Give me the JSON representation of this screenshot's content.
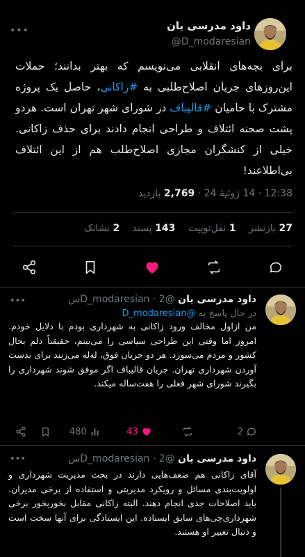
{
  "main_tweet": {
    "author_name": "داود مدرسی یان",
    "handle": "@D_modaresian",
    "text_parts": [
      "برای بچه‌های انقلابی می‌نویسم که بهتر بدانند؛ حملات این‌روزهای جریان اصلاح‌طلبی به ",
      "#زاکانی",
      "، حاصل یک پروژه مشترک با حامیان ",
      "#قالیباف",
      " در شورای شهر تهران است. هردو پشت صحنه ائتلاف و طراحی انجام دادند برای حذف زاکانی. خیلی از کنشگران مجازی اصلاح‌طلب هم از این ائتلاف بی‌اطلاعند!"
    ],
    "time": "12:38",
    "date": "14 ژوئیهٔ 24",
    "views": "2,769",
    "views_label": "بازدید",
    "meta_sep": "·",
    "stats": {
      "reposts_count": "27",
      "reposts_label": "بازنشر",
      "quotes_count": "1",
      "quotes_label": "نقل‌توییت",
      "likes_count": "143",
      "likes_label": "پسند",
      "bookmarks_count": "2",
      "bookmarks_label": "نشانک"
    }
  },
  "reply1": {
    "author_name": "داود مدرسی یان",
    "handle": "@D_modaresian",
    "time_ago": "2س",
    "sep": "·",
    "reply_to_label": "در حال پاسخ به",
    "reply_to_handle": "@D_modaresian",
    "text": "من ازاول مخالف ورود زاکانی به شهرداری بودم با دلایل خودم. امروز اما وقتی این طراحی سیاسی را می‌بینم، حقیقتاً دلم بحال کشور و مردم می‌سوزد. هر دو جریان فوق، له‌له می‌زنند برای بدست آوردن شهرداری تهران. جریان قالیباف اگر موفق شوند شهرداری را بگیرند شورای شهر فعلی را هفت‌ساله میکند.",
    "views": "480",
    "likes": "43",
    "replies": "2"
  },
  "reply2": {
    "author_name": "داود مدرسی یان",
    "handle": "@D_modaresian",
    "time_ago": "2س",
    "sep": "·",
    "text": "آقای زاکانی هم ضعف‌هایی دارند در بحث مدیریت شهرداری و اولویت‌بندی مسائل و رویکرد مدیریتی و استفاده از برخی مدیران. باید اصلاحات جدی انجام دهند. البته زاکانی مقابل بخوربخور برخی شهرداری‌چی‌های سابق ایستاده. این ایستادگی برای آنها سخت است و دنبال تغییر او هستند."
  },
  "colors": {
    "background": "#000000",
    "text": "#e7e9ea",
    "muted": "#71767b",
    "link": "#1d9bf0",
    "like": "#f91880"
  },
  "icons": [
    "more-icon",
    "share-icon",
    "bookmark-icon",
    "heart-icon",
    "repost-icon",
    "reply-icon",
    "views-icon"
  ]
}
